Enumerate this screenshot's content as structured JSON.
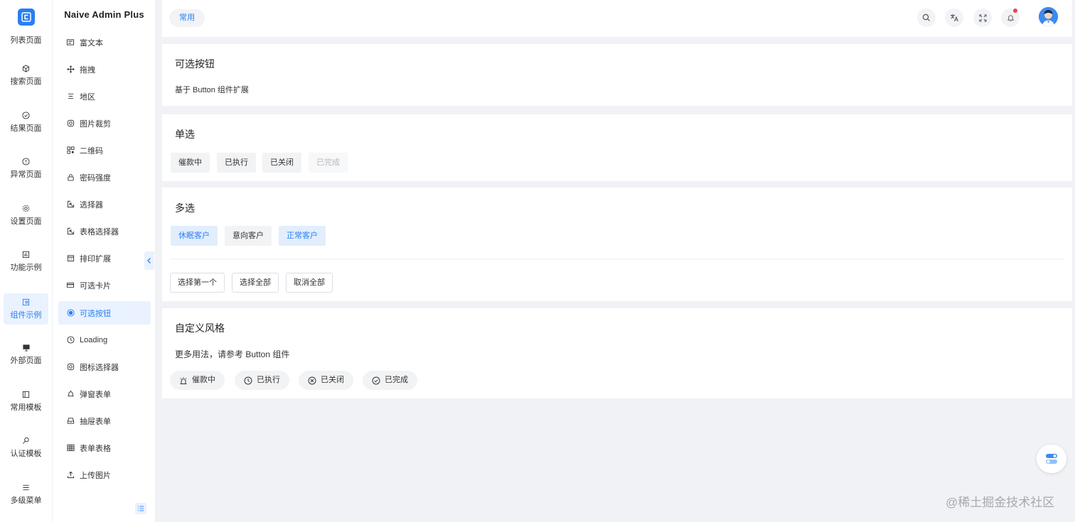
{
  "rail": {
    "items": [
      {
        "label": "列表页面",
        "icon": "list-icon"
      },
      {
        "label": "搜索页面",
        "icon": "cube-icon"
      },
      {
        "label": "结果页面",
        "icon": "check-circle-icon"
      },
      {
        "label": "异常页面",
        "icon": "alert-circle-icon"
      },
      {
        "label": "设置页面",
        "icon": "gear-icon"
      },
      {
        "label": "功能示例",
        "icon": "chart-icon"
      },
      {
        "label": "组件示例",
        "icon": "component-icon"
      },
      {
        "label": "外部页面",
        "icon": "monitor-icon"
      },
      {
        "label": "常用模板",
        "icon": "template-icon"
      },
      {
        "label": "认证模板",
        "icon": "key-icon"
      },
      {
        "label": "多级菜单",
        "icon": "menu-icon"
      }
    ]
  },
  "submenu": {
    "title": "Naive Admin Plus",
    "items": [
      {
        "label": "富文本",
        "icon": "rich-text-icon"
      },
      {
        "label": "拖拽",
        "icon": "drag-icon"
      },
      {
        "label": "地区",
        "icon": "region-icon"
      },
      {
        "label": "图片裁剪",
        "icon": "crop-icon"
      },
      {
        "label": "二维码",
        "icon": "qrcode-icon"
      },
      {
        "label": "密码强度",
        "icon": "lock-icon"
      },
      {
        "label": "选择器",
        "icon": "selector-icon"
      },
      {
        "label": "表格选择器",
        "icon": "table-selector-icon"
      },
      {
        "label": "排印扩展",
        "icon": "calendar-icon"
      },
      {
        "label": "可选卡片",
        "icon": "card-icon"
      },
      {
        "label": "可选按钮",
        "icon": "radio-icon"
      },
      {
        "label": "Loading",
        "icon": "clock-icon"
      },
      {
        "label": "图标选择器",
        "icon": "instagram-icon"
      },
      {
        "label": "弹窗表单",
        "icon": "bell-icon"
      },
      {
        "label": "抽屉表单",
        "icon": "inbox-icon"
      },
      {
        "label": "表单表格",
        "icon": "grid-icon"
      },
      {
        "label": "上传图片",
        "icon": "upload-icon"
      }
    ]
  },
  "header": {
    "tab_label": "常用"
  },
  "cards": {
    "intro": {
      "title": "可选按钮",
      "desc": "基于 Button 组件扩展"
    },
    "single": {
      "title": "单选",
      "options": [
        {
          "label": "催款中"
        },
        {
          "label": "已执行"
        },
        {
          "label": "已关闭"
        },
        {
          "label": "已完成"
        }
      ]
    },
    "multi": {
      "title": "多选",
      "options": [
        {
          "label": "休眠客户"
        },
        {
          "label": "意向客户"
        },
        {
          "label": "正常客户"
        }
      ],
      "selected": [
        "休眠客户",
        "正常客户"
      ],
      "actions": [
        {
          "label": "选择第一个"
        },
        {
          "label": "选择全部"
        },
        {
          "label": "取消全部"
        }
      ]
    },
    "custom": {
      "title": "自定义风格",
      "desc": "更多用法，请参考 Button 组件",
      "pills": [
        {
          "label": "催款中",
          "icon": "alarm-icon"
        },
        {
          "label": "已执行",
          "icon": "clock-icon"
        },
        {
          "label": "已关闭",
          "icon": "close-circle-icon"
        },
        {
          "label": "已完成",
          "icon": "check-circle-icon"
        }
      ]
    }
  },
  "watermark": "@稀土掘金技术社区",
  "colors": {
    "accent": "#2a7ef4",
    "bg": "#f0f2f5"
  }
}
